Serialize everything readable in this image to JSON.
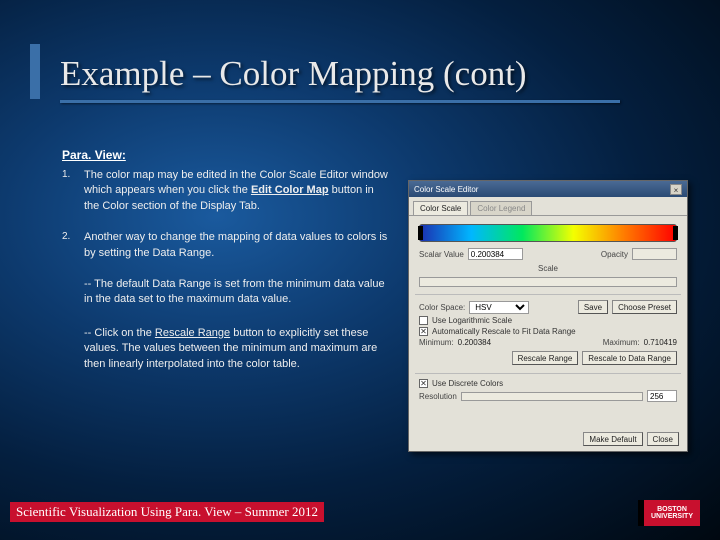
{
  "title": "Example – Color Mapping (cont)",
  "subtitle": "Para. View:",
  "items": [
    {
      "num": "1.",
      "text_pre": "The color map may be edited in the Color Scale Editor window which appears when you click the ",
      "text_u": "Edit Color Map",
      "text_post": " button in the Color section of the Display Tab."
    },
    {
      "num": "2.",
      "text_pre": "Another way to change the mapping of data values to colors is by setting the Data Range.",
      "text_u": "",
      "text_post": ""
    }
  ],
  "subs": [
    "-- The default Data Range is set from the minimum data value in the data set to the maximum data value.",
    {
      "pre": "-- Click on the ",
      "u": "Rescale Range",
      "post": " button to explicitly set these values. The values between the minimum and maximum are then linearly interpolated into the color table."
    }
  ],
  "footer": "Scientific Visualization Using Para. View – Summer 2012",
  "logo": "BOSTON UNIVERSITY",
  "dialog": {
    "title": "Color Scale Editor",
    "tabs": {
      "active": "Color Scale",
      "inactive": "Color Legend"
    },
    "row_scalar": {
      "label": "Scalar Value",
      "value": "0.200384",
      "opacity_label": "Opacity"
    },
    "row_scale": "Scale",
    "colorspace_label": "Color Space:",
    "colorspace_value": "HSV",
    "btn_save": "Save",
    "btn_preset": "Choose Preset",
    "cb_log": "Use Logarithmic Scale",
    "cb_auto": "Automatically Rescale to Fit Data Range",
    "min_label": "Minimum:",
    "min_value": "0.200384",
    "max_label": "Maximum:",
    "max_value": "0.710419",
    "btn_rescale": "Rescale Range",
    "btn_rescale_data": "Rescale to Data Range",
    "cb_discrete": "Use Discrete Colors",
    "res_label": "Resolution",
    "res_value": "256",
    "btn_default": "Make Default",
    "btn_close": "Close"
  }
}
